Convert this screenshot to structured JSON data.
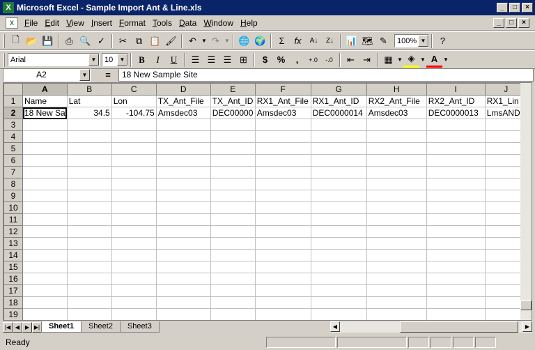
{
  "window": {
    "title": "Microsoft Excel - Sample Import Ant & Line.xls",
    "minimize": "_",
    "maximize": "□",
    "close": "×"
  },
  "menu": [
    "File",
    "Edit",
    "View",
    "Insert",
    "Format",
    "Tools",
    "Data",
    "Window",
    "Help"
  ],
  "toolbar": {
    "zoom": "100%",
    "font": "Arial",
    "size": "10",
    "bold": "B",
    "italic": "I",
    "underline": "U",
    "currency": "$",
    "percent": "%",
    "comma": ","
  },
  "formula_bar": {
    "name_box": "A2",
    "equals": "=",
    "value": "18 New Sample Site"
  },
  "grid": {
    "columns": [
      "A",
      "B",
      "C",
      "D",
      "E",
      "F",
      "G",
      "H",
      "I",
      "J"
    ],
    "row_numbers": [
      "1",
      "2",
      "3",
      "4",
      "5",
      "6",
      "7",
      "8",
      "9",
      "10",
      "11",
      "12",
      "13",
      "14",
      "15",
      "16",
      "17",
      "18",
      "19"
    ],
    "rows": [
      [
        "Name",
        "Lat",
        "Lon",
        "TX_Ant_File",
        "TX_Ant_ID",
        "RX1_Ant_File",
        "RX1_Ant_ID",
        "RX2_Ant_File",
        "RX2_Ant_ID",
        "RX1_Lin"
      ],
      [
        "18 New Sa",
        "34.5",
        "-104.75",
        "Amsdec03",
        "DEC00000",
        "Amsdec03",
        "DEC0000014",
        "Amsdec03",
        "DEC0000013",
        "LmsAND"
      ]
    ]
  },
  "sheets": [
    "Sheet1",
    "Sheet2",
    "Sheet3"
  ],
  "status": "Ready"
}
